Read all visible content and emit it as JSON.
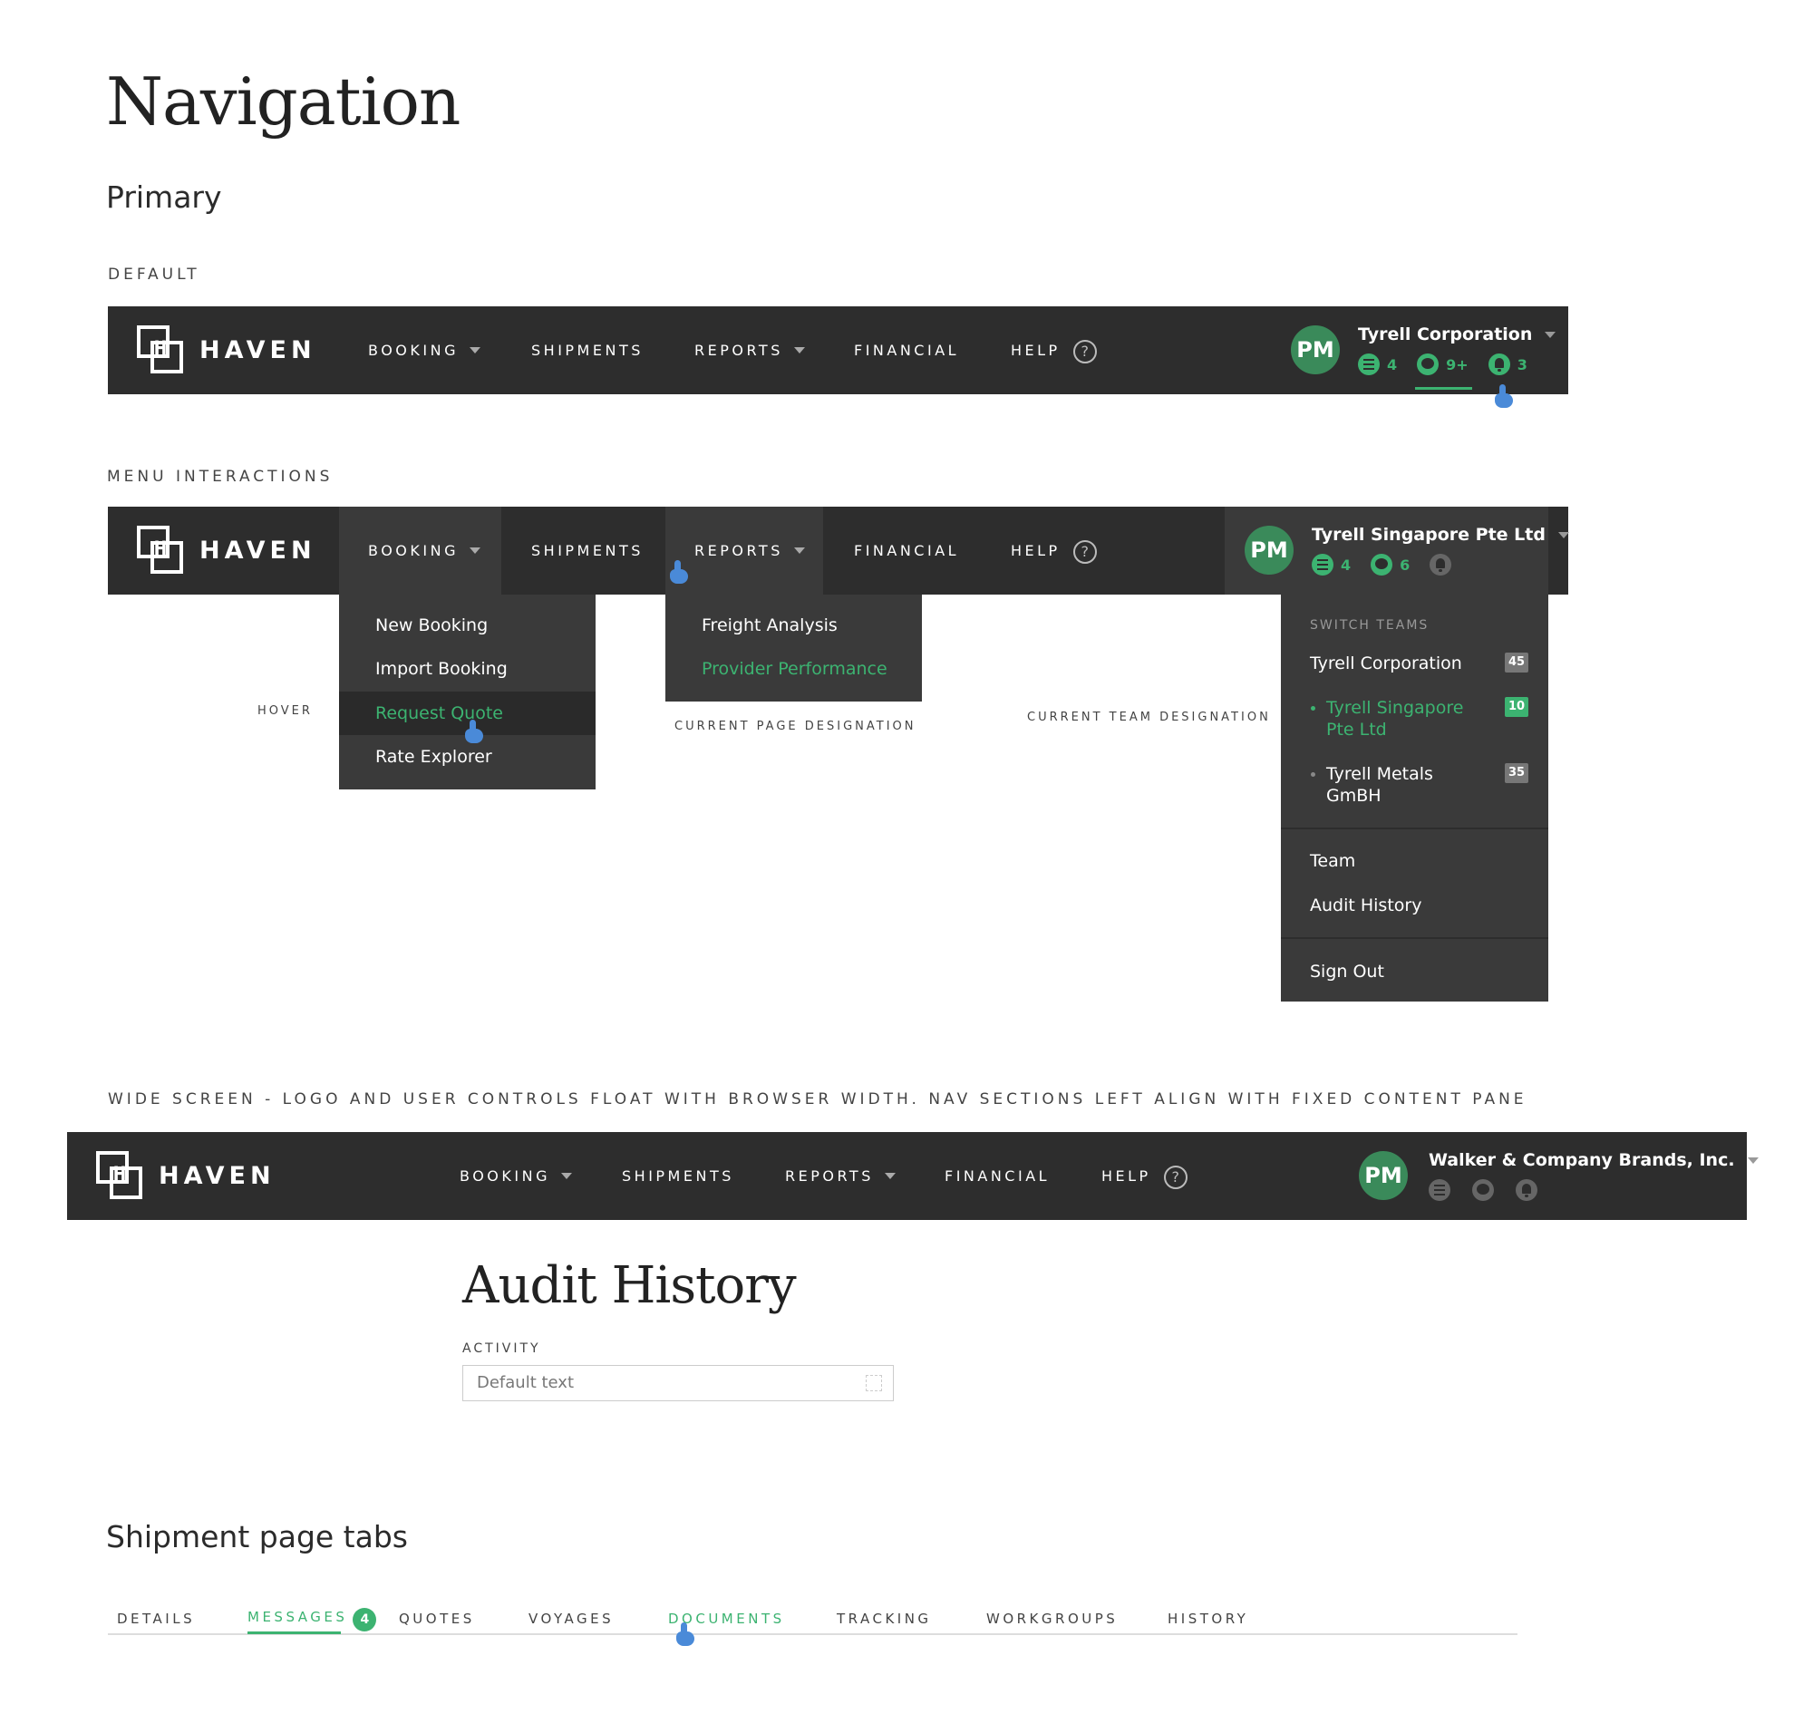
{
  "page": {
    "title": "Navigation",
    "primary_heading": "Primary",
    "sections": {
      "default": "DEFAULT",
      "menu_interactions": "MENU INTERACTIONS",
      "wide_screen": "WIDE SCREEN - LOGO AND USER CONTROLS FLOAT WITH BROWSER WIDTH. NAV SECTIONS LEFT ALIGN WITH FIXED CONTENT PANE"
    },
    "annotations": {
      "hover": "HOVER",
      "current_page": "CURRENT PAGE DESIGNATION",
      "current_team": "CURRENT TEAM DESIGNATION"
    }
  },
  "brand": {
    "name": "HAVEN",
    "mark_letter": "H"
  },
  "nav": {
    "booking": "BOOKING",
    "shipments": "SHIPMENTS",
    "reports": "REPORTS",
    "financial": "FINANCIAL",
    "help": "HELP",
    "help_icon": "?"
  },
  "user": {
    "initials": "PM"
  },
  "nav_default": {
    "company": "Tyrell Corporation",
    "tasks_count": "4",
    "messages_count": "9+",
    "alerts_count": "3"
  },
  "nav_menu": {
    "company": "Tyrell Singapore Pte Ltd",
    "tasks_count": "4",
    "messages_count": "6"
  },
  "booking_menu": {
    "items": [
      "New Booking",
      "Import Booking",
      "Request Quote",
      "Rate Explorer"
    ]
  },
  "reports_menu": {
    "items": [
      "Freight Analysis",
      "Provider Performance"
    ]
  },
  "team_menu": {
    "label": "SWITCH TEAMS",
    "teams": [
      {
        "name": "Tyrell Corporation",
        "count": "45"
      },
      {
        "name_line1": "Tyrell Singapore",
        "name_line2": "Pte Ltd",
        "count": "10"
      },
      {
        "name_line1": "Tyrell Metals",
        "name_line2": "GmBH",
        "count": "35"
      }
    ],
    "team": "Team",
    "audit_history": "Audit History",
    "sign_out": "Sign Out"
  },
  "nav_wide": {
    "company": "Walker & Company Brands, Inc."
  },
  "audit": {
    "title": "Audit History",
    "activity_label": "ACTIVITY",
    "activity_value": "Default text"
  },
  "tabs": {
    "heading": "Shipment page tabs",
    "items": [
      "DETAILS",
      "MESSAGES",
      "QUOTES",
      "VOYAGES",
      "DOCUMENTS",
      "TRACKING",
      "WORKGROUPS",
      "HISTORY"
    ],
    "messages_badge": "4"
  },
  "colors": {
    "nav_bg": "#2d2d2d",
    "accent": "#3cb371",
    "avatar": "#3a8a5a",
    "pointer": "#4a8ad8"
  }
}
